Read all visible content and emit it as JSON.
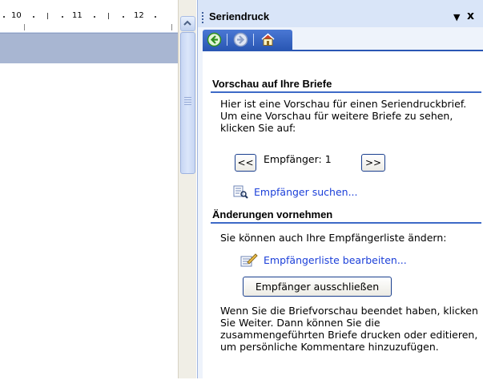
{
  "ruler": {
    "labels": [
      "10",
      "11",
      "12"
    ]
  },
  "task_pane": {
    "title": "Seriendruck",
    "menu_icon": "chevron-down-icon",
    "close_label": "x",
    "nav": {
      "back_icon": "back-arrow-icon",
      "forward_icon": "forward-arrow-icon",
      "home_icon": "home-icon"
    },
    "preview_section": {
      "title": "Vorschau auf Ihre Briefe",
      "description": "Hier ist eine Vorschau für einen Seriendruckbrief. Um eine Vorschau für weitere Briefe zu sehen, klicken Sie auf:",
      "prev_label": "<<",
      "recipient_text": "Empfänger: 1",
      "next_label": ">>",
      "find_link": "Empfänger suchen..."
    },
    "changes_section": {
      "title": "Änderungen vornehmen",
      "description": "Sie können auch Ihre Empfängerliste ändern:",
      "edit_link": "Empfängerliste bearbeiten...",
      "exclude_button": "Empfänger ausschließen",
      "footer_text": "Wenn Sie die Briefvorschau beendet haben, klicken Sie Weiter. Dann können Sie die zusammengeführten Briefe drucken oder editieren, um persönliche Kommentare hinzuzufügen."
    }
  },
  "colors": {
    "section_rule": "#3d6ac7",
    "link": "#1b3fd9",
    "nav_bar": "#2a57b4"
  }
}
